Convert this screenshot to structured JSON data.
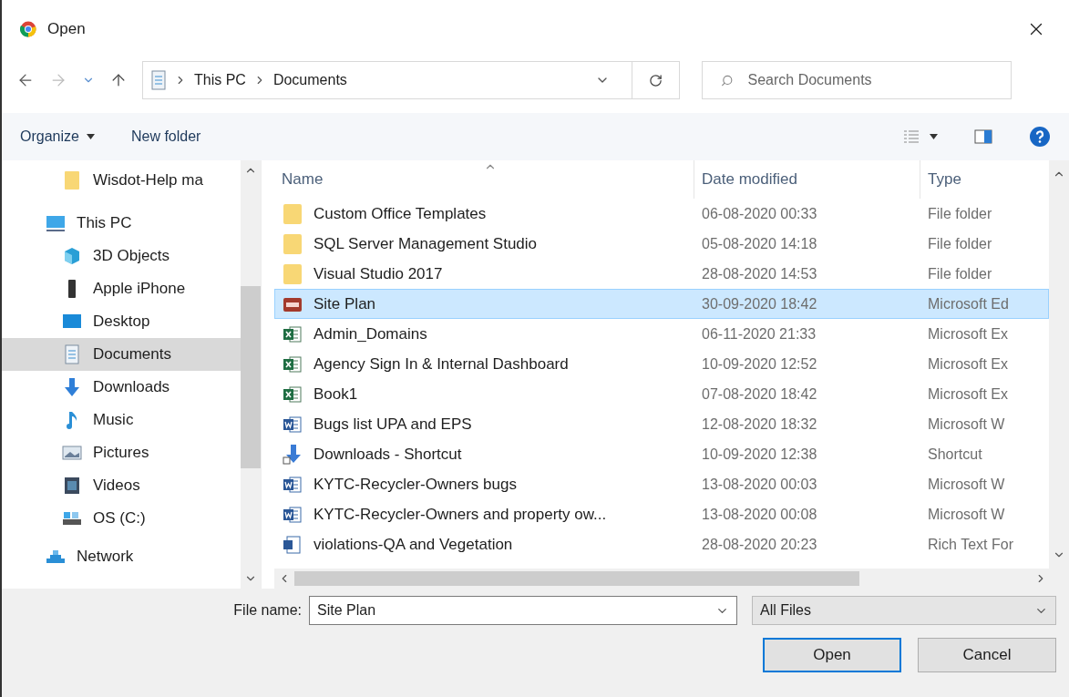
{
  "window": {
    "title": "Open"
  },
  "address": {
    "crumbs": [
      "This PC",
      "Documents"
    ]
  },
  "search": {
    "placeholder": "Search Documents"
  },
  "toolbar": {
    "organize": "Organize",
    "new_folder": "New folder"
  },
  "sidebar": {
    "items": [
      {
        "label": "Wisdot-Help ma",
        "kind": "folder",
        "selected": false
      },
      {
        "label": "This PC",
        "kind": "pc",
        "selected": false
      },
      {
        "label": "3D Objects",
        "kind": "cube",
        "selected": false
      },
      {
        "label": "Apple iPhone",
        "kind": "phone",
        "selected": false
      },
      {
        "label": "Desktop",
        "kind": "desktop",
        "selected": false
      },
      {
        "label": "Documents",
        "kind": "documents",
        "selected": true
      },
      {
        "label": "Downloads",
        "kind": "download",
        "selected": false
      },
      {
        "label": "Music",
        "kind": "music",
        "selected": false
      },
      {
        "label": "Pictures",
        "kind": "pictures",
        "selected": false
      },
      {
        "label": "Videos",
        "kind": "videos",
        "selected": false
      },
      {
        "label": "OS (C:)",
        "kind": "drive",
        "selected": false
      },
      {
        "label": "Network",
        "kind": "network",
        "selected": false
      }
    ]
  },
  "table": {
    "columns": [
      "Name",
      "Date modified",
      "Type"
    ],
    "rows": [
      {
        "name": "Custom Office Templates",
        "date": "06-08-2020 00:33",
        "type": "File folder",
        "kind": "folder",
        "selected": false
      },
      {
        "name": "SQL Server Management Studio",
        "date": "05-08-2020 14:18",
        "type": "File folder",
        "kind": "folder",
        "selected": false
      },
      {
        "name": "Visual Studio 2017",
        "date": "28-08-2020 14:53",
        "type": "File folder",
        "kind": "folder",
        "selected": false
      },
      {
        "name": "Site Plan",
        "date": "30-09-2020 18:42",
        "type": "Microsoft Ed",
        "kind": "pdf",
        "selected": true
      },
      {
        "name": "Admin_Domains",
        "date": "06-11-2020 21:33",
        "type": "Microsoft Ex",
        "kind": "excel",
        "selected": false
      },
      {
        "name": "Agency Sign In & Internal Dashboard",
        "date": "10-09-2020 12:52",
        "type": "Microsoft Ex",
        "kind": "excel",
        "selected": false
      },
      {
        "name": "Book1",
        "date": "07-08-2020 18:42",
        "type": "Microsoft Ex",
        "kind": "excel",
        "selected": false
      },
      {
        "name": "Bugs list UPA and EPS",
        "date": "12-08-2020 18:32",
        "type": "Microsoft W",
        "kind": "word",
        "selected": false
      },
      {
        "name": "Downloads - Shortcut",
        "date": "10-09-2020 12:38",
        "type": "Shortcut",
        "kind": "shortcut",
        "selected": false
      },
      {
        "name": "KYTC-Recycler-Owners  bugs",
        "date": "13-08-2020 00:03",
        "type": "Microsoft W",
        "kind": "word",
        "selected": false
      },
      {
        "name": "KYTC-Recycler-Owners and property ow...",
        "date": "13-08-2020 00:08",
        "type": "Microsoft W",
        "kind": "word",
        "selected": false
      },
      {
        "name": "violations-QA and Vegetation",
        "date": "28-08-2020 20:23",
        "type": "Rich Text For",
        "kind": "rtf",
        "selected": false
      }
    ]
  },
  "footer": {
    "file_name_label": "File name:",
    "file_name": "Site Plan",
    "filter": "All Files",
    "open": "Open",
    "cancel": "Cancel"
  }
}
